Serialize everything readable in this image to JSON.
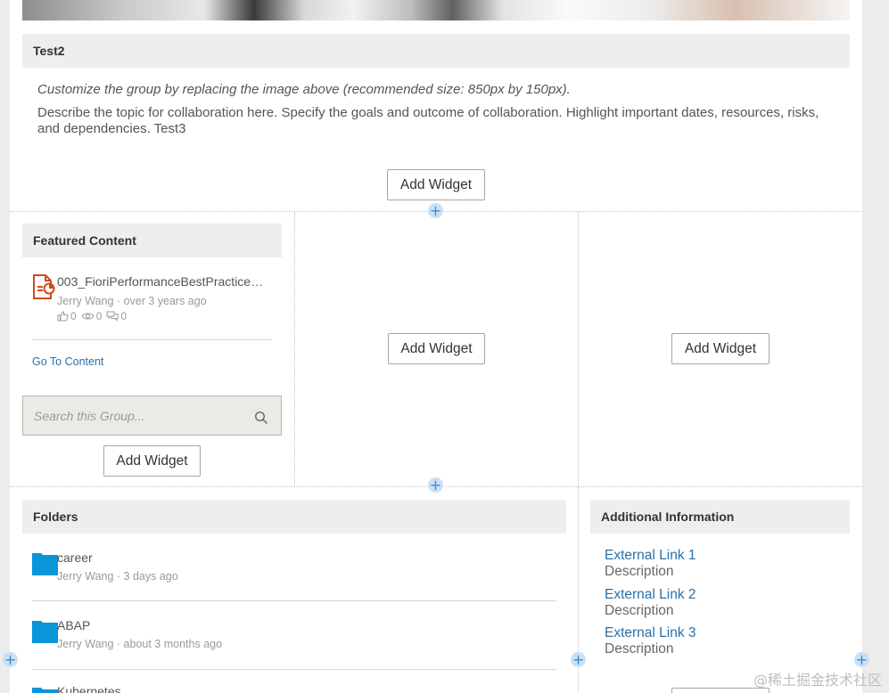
{
  "group": {
    "title": "Test2",
    "customize_note": "Customize the group by replacing the image above (recommended size: 850px by 150px).",
    "description": "Describe the topic for collaboration here. Specify the goals and outcome of collaboration. Highlight important dates, resources, risks, and dependencies. Test3"
  },
  "widgets": {
    "add_label": "Add Widget"
  },
  "featured": {
    "header": "Featured Content",
    "item_title": "003_FioriPerformanceBestPractice…",
    "item_meta": "Jerry Wang · over 3 years ago",
    "likes": "0",
    "views": "0",
    "comments": "0",
    "goto_label": "Go To Content"
  },
  "search": {
    "placeholder": "Search this Group..."
  },
  "folders": {
    "header": "Folders",
    "items": [
      {
        "name": "career",
        "meta": "Jerry Wang · 3 days ago"
      },
      {
        "name": "ABAP",
        "meta": "Jerry Wang · about 3 months ago"
      },
      {
        "name": "Kubernetes",
        "meta": ""
      }
    ]
  },
  "additional": {
    "header": "Additional Information",
    "links": [
      {
        "label": "External Link 1",
        "desc": "Description"
      },
      {
        "label": "External Link 2",
        "desc": "Description"
      },
      {
        "label": "External Link 3",
        "desc": "Description"
      }
    ]
  },
  "watermark": "@稀土掘金技术社区",
  "colors": {
    "link": "#2a6fa8",
    "folder": "#0a95d9",
    "plus_bg": "#c9e0f5",
    "header_bg": "#eeeeee"
  }
}
